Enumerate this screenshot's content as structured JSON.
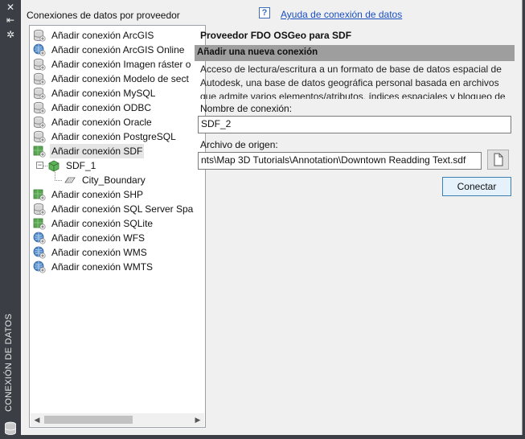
{
  "sidebar": {
    "title": "CONEXIÓN DE DATOS",
    "controls": [
      "close-icon",
      "collapse-icon",
      "settings-icon"
    ]
  },
  "tree": {
    "title": "Conexiones de datos por proveedor",
    "items": [
      {
        "label": "Añadir conexión ArcGIS",
        "icon": "database-icon"
      },
      {
        "label": "Añadir conexión ArcGIS Online",
        "icon": "globe-icon"
      },
      {
        "label": "Añadir conexión Imagen ráster o",
        "icon": "database-icon"
      },
      {
        "label": "Añadir conexión Modelo de sect",
        "icon": "database-icon"
      },
      {
        "label": "Añadir conexión MySQL",
        "icon": "database-icon"
      },
      {
        "label": "Añadir conexión ODBC",
        "icon": "database-icon"
      },
      {
        "label": "Añadir conexión Oracle",
        "icon": "database-icon"
      },
      {
        "label": "Añadir conexión PostgreSQL",
        "icon": "database-icon"
      },
      {
        "label": "Añadir conexión SDF",
        "icon": "map-file-icon",
        "selected": true
      },
      {
        "label": "SDF_1",
        "icon": "cube-icon",
        "level": 1
      },
      {
        "label": "City_Boundary",
        "icon": "feature-class-icon",
        "level": 2
      },
      {
        "label": "Añadir conexión SHP",
        "icon": "map-file-icon"
      },
      {
        "label": "Añadir conexión SQL Server Spa",
        "icon": "database-icon"
      },
      {
        "label": "Añadir conexión SQLite",
        "icon": "map-file-icon"
      },
      {
        "label": "Añadir conexión WFS",
        "icon": "globe-icon"
      },
      {
        "label": "Añadir conexión WMS",
        "icon": "globe-icon"
      },
      {
        "label": "Añadir conexión WMTS",
        "icon": "globe-icon"
      }
    ]
  },
  "help": {
    "link": "Ayuda de conexión de datos"
  },
  "provider": {
    "title": "Proveedor FDO OSGeo para SDF",
    "section": "Añadir una nueva conexión",
    "description": "Acceso de lectura/escritura a un formato de base de datos espacial de Autodesk, una base de datos geográfica personal basada en archivos que admite varios elementos/atributos, índices espaciales y bloqueo de",
    "connection_name_label": "Nombre de conexión:",
    "connection_name_value": "SDF_2",
    "source_file_label": "Archivo de origen:",
    "source_file_value": "nts\\Map 3D Tutorials\\Annotation\\Downtown Readding Text.sdf",
    "connect_label": "Conectar"
  },
  "colors": {
    "dark": "#3b3f45",
    "panel": "#f0f0f0",
    "section": "#9e9e9e",
    "link": "#1a4fc0"
  }
}
